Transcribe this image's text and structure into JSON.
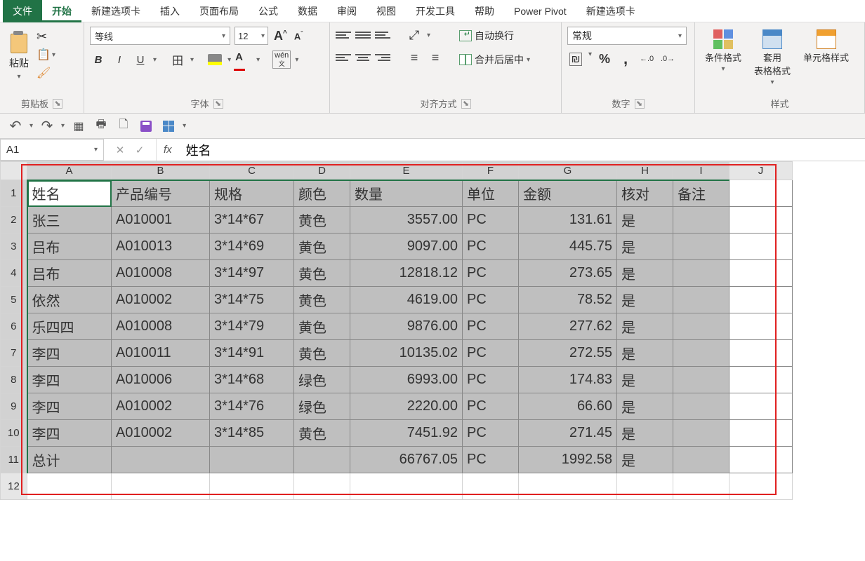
{
  "menu": {
    "file": "文件",
    "home": "开始",
    "newtab1": "新建选项卡",
    "insert": "插入",
    "layout": "页面布局",
    "formulas": "公式",
    "data": "数据",
    "review": "审阅",
    "view": "视图",
    "dev": "开发工具",
    "help": "帮助",
    "pivot": "Power Pivot",
    "newtab2": "新建选项卡"
  },
  "ribbon": {
    "clipboard": {
      "paste": "粘贴",
      "label": "剪贴板"
    },
    "font": {
      "name": "等线",
      "size": "12",
      "label": "字体",
      "wen1": "wén",
      "wen2": "文"
    },
    "align": {
      "wrap": "自动换行",
      "merge": "合并后居中",
      "label": "对齐方式"
    },
    "number": {
      "format": "常规",
      "label": "数字"
    },
    "styles": {
      "cond": "条件格式",
      "tbl": "套用\n表格格式",
      "cell": "单元格样式",
      "label": "样式"
    }
  },
  "fbar": {
    "name": "A1",
    "formula": "姓名"
  },
  "cols": [
    "A",
    "B",
    "C",
    "D",
    "E",
    "F",
    "G",
    "H",
    "I",
    "J"
  ],
  "headers": [
    "姓名",
    "产品编号",
    "规格",
    "颜色",
    "数量",
    "单位",
    "金额",
    "核对",
    "备注"
  ],
  "rows": [
    [
      "张三",
      "A010001",
      "3*14*67",
      "黄色",
      "3557.00",
      "PC",
      "131.61",
      "是",
      ""
    ],
    [
      "吕布",
      "A010013",
      "3*14*69",
      "黄色",
      "9097.00",
      "PC",
      "445.75",
      "是",
      ""
    ],
    [
      "吕布",
      "A010008",
      "3*14*97",
      "黄色",
      "12818.12",
      "PC",
      "273.65",
      "是",
      ""
    ],
    [
      "依然",
      "A010002",
      "3*14*75",
      "黄色",
      "4619.00",
      "PC",
      "78.52",
      "是",
      ""
    ],
    [
      "乐四四",
      "A010008",
      "3*14*79",
      "黄色",
      "9876.00",
      "PC",
      "277.62",
      "是",
      ""
    ],
    [
      "李四",
      "A010011",
      "3*14*91",
      "黄色",
      "10135.02",
      "PC",
      "272.55",
      "是",
      ""
    ],
    [
      "李四",
      "A010006",
      "3*14*68",
      "绿色",
      "6993.00",
      "PC",
      "174.83",
      "是",
      ""
    ],
    [
      "李四",
      "A010002",
      "3*14*76",
      "绿色",
      "2220.00",
      "PC",
      "66.60",
      "是",
      ""
    ],
    [
      "李四",
      "A010002",
      "3*14*85",
      "黄色",
      "7451.92",
      "PC",
      "271.45",
      "是",
      ""
    ],
    [
      "总计",
      "",
      "",
      "",
      "66767.05",
      "PC",
      "1992.58",
      "是",
      ""
    ]
  ]
}
